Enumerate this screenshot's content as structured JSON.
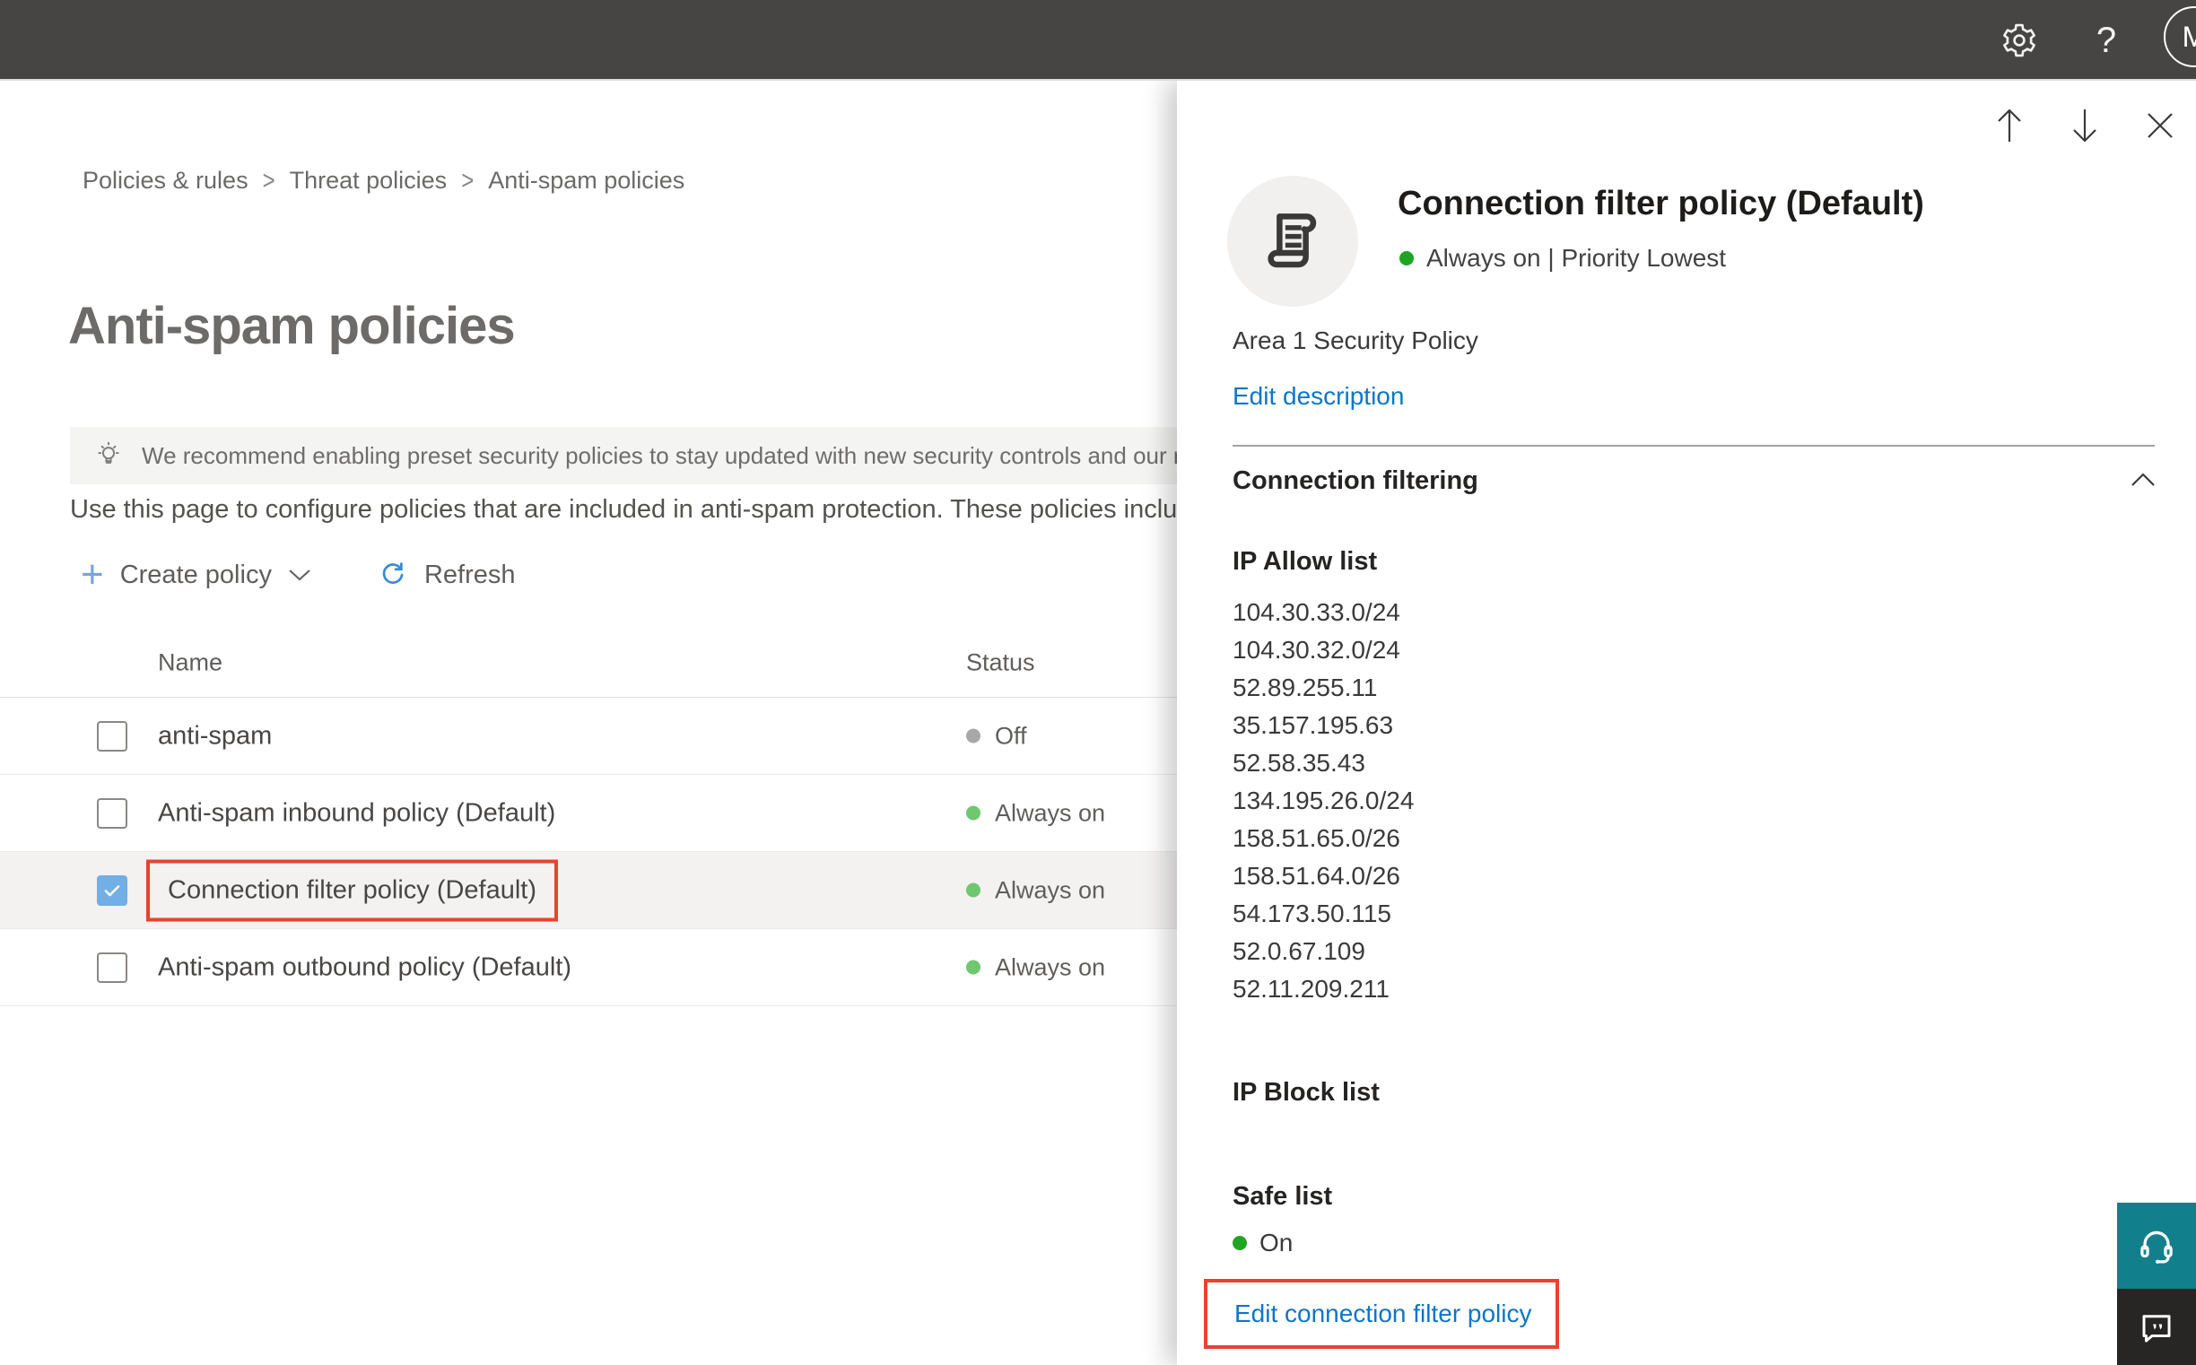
{
  "topbar": {
    "help_label": "?",
    "avatar_initial": "M"
  },
  "breadcrumb": {
    "items": [
      "Policies & rules",
      "Threat policies",
      "Anti-spam policies"
    ],
    "separator": ">"
  },
  "page": {
    "title": "Anti-spam policies",
    "banner_text": "We recommend enabling preset security policies to stay updated with new security controls and our recomme",
    "description": "Use this page to configure policies that are included in anti-spam protection. These policies include"
  },
  "toolbar": {
    "create_policy_label": "Create policy",
    "refresh_label": "Refresh"
  },
  "table": {
    "columns": [
      "Name",
      "Status"
    ],
    "rows": [
      {
        "name": "anti-spam",
        "status": "Off"
      },
      {
        "name": "Anti-spam inbound policy (Default)",
        "status": "Always on"
      },
      {
        "name": "Connection filter policy (Default)",
        "status": "Always on"
      },
      {
        "name": "Anti-spam outbound policy (Default)",
        "status": "Always on"
      }
    ]
  },
  "panel": {
    "title": "Connection filter policy (Default)",
    "status_line": "Always on | Priority Lowest",
    "description": "Area 1 Security Policy",
    "edit_description_label": "Edit description",
    "section_title": "Connection filtering",
    "ip_allow": {
      "title": "IP Allow list",
      "entries": [
        "104.30.33.0/24",
        "104.30.32.0/24",
        "52.89.255.11",
        "35.157.195.63",
        "52.58.35.43",
        "134.195.26.0/24",
        "158.51.65.0/26",
        "158.51.64.0/26",
        "54.173.50.115",
        "52.0.67.109",
        "52.11.209.211"
      ]
    },
    "ip_block": {
      "title": "IP Block list"
    },
    "safe_list": {
      "title": "Safe list",
      "status": "On"
    },
    "edit_link_label": "Edit connection filter policy"
  },
  "colors": {
    "accent_blue": "#0b76c8",
    "checkbox_blue": "#71afe5",
    "annotation_red": "#e8432c",
    "status_green": "#6fc76f",
    "status_gray": "#a8a8a8",
    "help_teal": "#12808c",
    "topbar_dark": "#474543"
  }
}
